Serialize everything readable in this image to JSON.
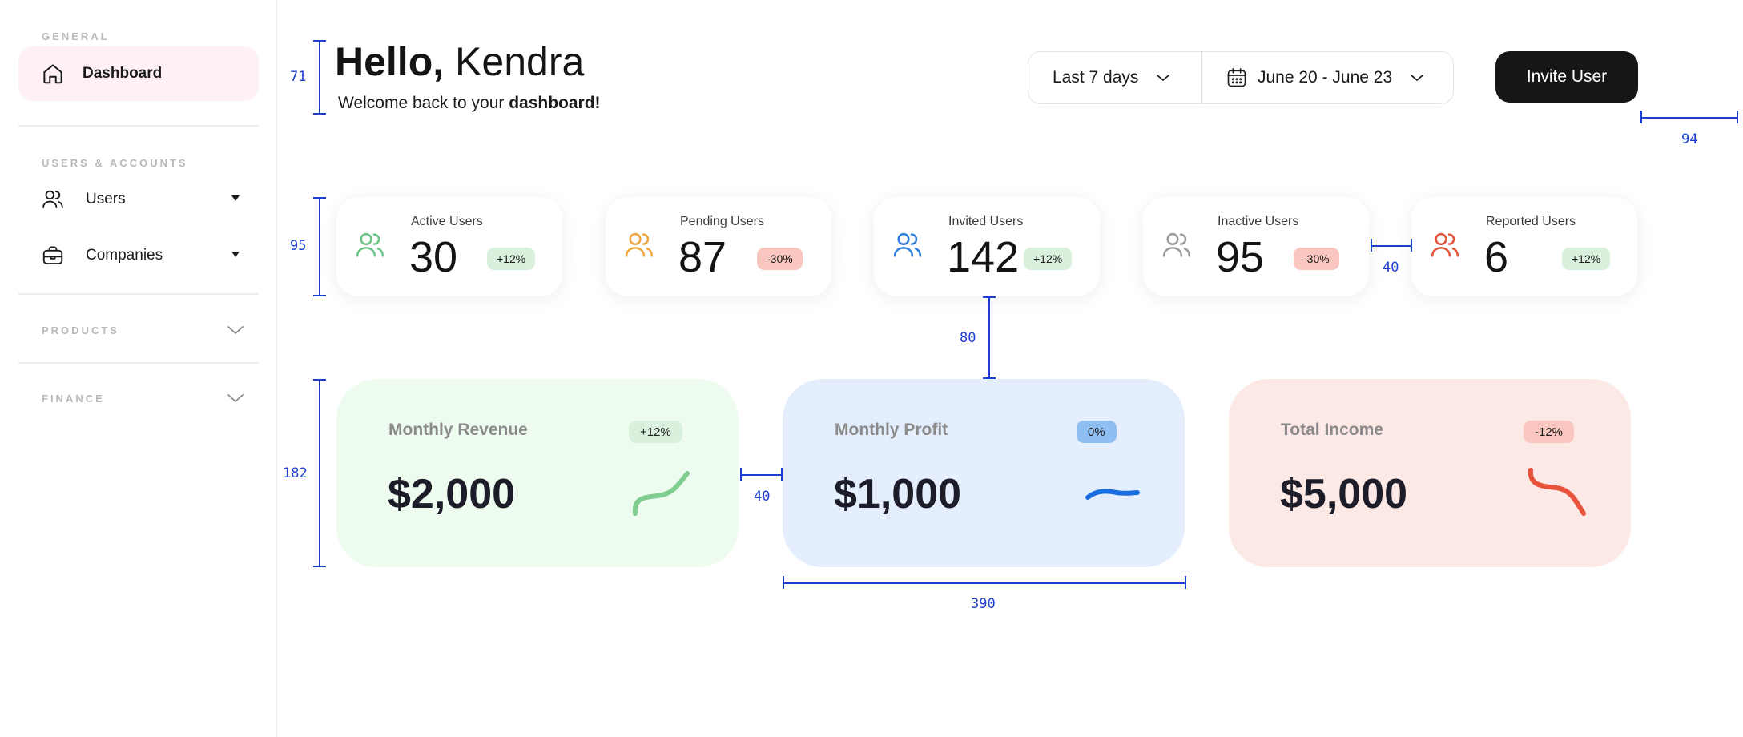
{
  "sidebar": {
    "general_label": "GENERAL",
    "dashboard_label": "Dashboard",
    "users_accounts_label": "USERS & ACCOUNTS",
    "users_label": "Users",
    "companies_label": "Companies",
    "products_label": "PRODUCTS",
    "finance_label": "FINANCE"
  },
  "header": {
    "hello": "Hello,",
    "name": "Kendra",
    "welcome_prefix": "Welcome back to your ",
    "welcome_bold": "dashboard!"
  },
  "filters": {
    "range": "Last 7 days",
    "dates": "June 20 - June 23"
  },
  "invite_label": "Invite User",
  "stats": [
    {
      "label": "Active Users",
      "value": "30",
      "badge": "+12%",
      "color": "#6cc386"
    },
    {
      "label": "Pending Users",
      "value": "87",
      "badge": "-30%",
      "color": "#efa53a"
    },
    {
      "label": "Invited Users",
      "value": "142",
      "badge": "+12%",
      "color": "#2c7fe0"
    },
    {
      "label": "Inactive Users",
      "value": "95",
      "badge": "-30%",
      "color": "#9a9a9a"
    },
    {
      "label": "Reported Users",
      "value": "6",
      "badge": "+12%",
      "color": "#e2533a"
    }
  ],
  "metrics": [
    {
      "label": "Monthly Revenue",
      "value": "$2,000",
      "badge": "+12%",
      "bg": "#eefbef",
      "trend": "#7fce8f"
    },
    {
      "label": "Monthly Profit",
      "value": "$1,000",
      "badge": "0%",
      "bg": "#e5eefc",
      "trend": "#1a6ee0"
    },
    {
      "label": "Total Income",
      "value": "$5,000",
      "badge": "-12%",
      "bg": "#fce8e5",
      "trend": "#e9523a"
    }
  ],
  "annotations": {
    "header_height": "71",
    "stats_height": "95",
    "metric_height": "182",
    "gap_vertical": "80",
    "gap_stats": "40",
    "gap_metrics": "40",
    "right_margin": "94",
    "metric_width": "390"
  },
  "colors": {
    "accent_dark": "#161616",
    "annotation_blue": "#1d3fd1",
    "active_nav_bg": "#fff1f3"
  }
}
